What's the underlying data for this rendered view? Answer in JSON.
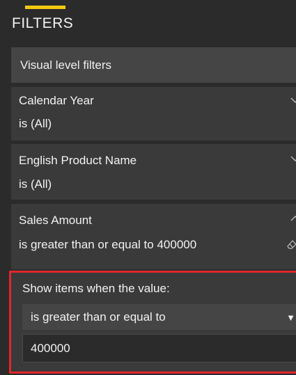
{
  "header": {
    "title": "FILTERS"
  },
  "section": {
    "label": "Visual level filters"
  },
  "filters": [
    {
      "name": "Calendar Year",
      "condition": "is (All)",
      "expanded": false,
      "icon": "chevron-down-icon"
    },
    {
      "name": "English Product Name",
      "condition": "is (All)",
      "expanded": false,
      "icon": "chevron-down-icon"
    },
    {
      "name": "Sales Amount",
      "condition": "is greater than or equal to 400000",
      "expanded": true,
      "icon": "chevron-up-icon"
    }
  ],
  "advanced": {
    "show_label": "Show items when the value:",
    "operator": "is greater than or equal to",
    "value": "400000"
  },
  "colors": {
    "accent": "#f2c811",
    "highlight_border": "#e0272b",
    "panel": "#2b2b2b",
    "card": "#3a3a3a"
  }
}
